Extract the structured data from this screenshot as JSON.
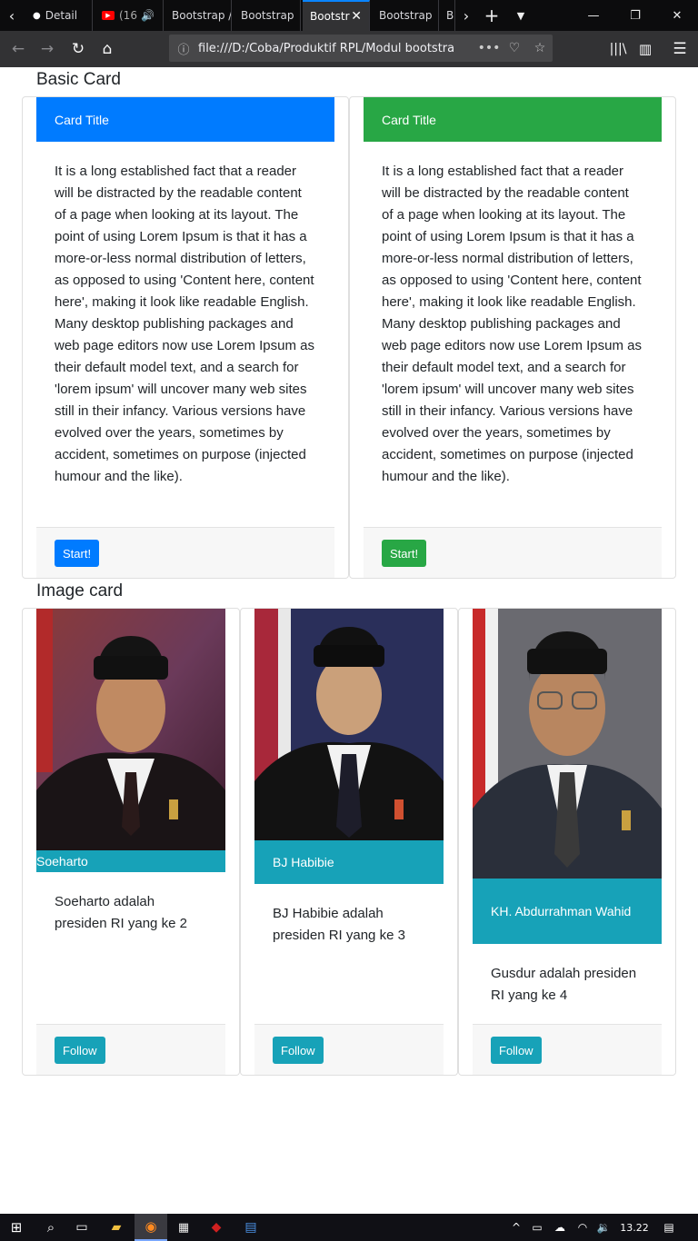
{
  "browser": {
    "tabs": [
      {
        "label": "Detail",
        "icon": "dot-icon",
        "active": false
      },
      {
        "label": "(16",
        "icon": "youtube-icon",
        "active": false
      },
      {
        "label": "Bootstrap /",
        "active": false
      },
      {
        "label": "Bootstrap",
        "active": false
      },
      {
        "label": "Bootstr",
        "active": true
      },
      {
        "label": "Bootstrap",
        "active": false
      },
      {
        "label": "B",
        "active": false
      }
    ],
    "url": "file:///D:/Coba/Produktif RPL/Modul bootstra",
    "url_more": "•••"
  },
  "page": {
    "basic_section_title": "Basic Card",
    "basic_cards": [
      {
        "header": "Card Title",
        "header_color": "#007bff",
        "body": "It is a long established fact that a reader will be distracted by the readable content of a page when looking at its layout. The point of using Lorem Ipsum is that it has a more-or-less normal distribution of letters, as opposed to using 'Content here, content here', making it look like readable English. Many desktop publishing packages and web page editors now use Lorem Ipsum as their default model text, and a search for 'lorem ipsum' will uncover many web sites still in their infancy. Various versions have evolved over the years, sometimes by accident, sometimes on purpose (injected humour and the like).",
        "button": "Start!",
        "button_color": "#007bff"
      },
      {
        "header": "Card Title",
        "header_color": "#28a745",
        "body": "It is a long established fact that a reader will be distracted by the readable content of a page when looking at its layout. The point of using Lorem Ipsum is that it has a more-or-less normal distribution of letters, as opposed to using 'Content here, content here', making it look like readable English. Many desktop publishing packages and web page editors now use Lorem Ipsum as their default model text, and a search for 'lorem ipsum' will uncover many web sites still in their infancy. Various versions have evolved over the years, sometimes by accident, sometimes on purpose (injected humour and the like).",
        "button": "Start!",
        "button_color": "#28a745"
      }
    ],
    "image_section_title": "Image card",
    "image_cards": [
      {
        "name": "Soeharto",
        "text": "Soeharto adalah presiden RI yang ke 2",
        "button": "Follow"
      },
      {
        "name": "BJ Habibie",
        "text": "BJ Habibie adalah presiden RI yang ke 3",
        "button": "Follow"
      },
      {
        "name": "KH. Abdurrahman Wahid",
        "text": "Gusdur adalah presiden RI yang ke 4",
        "button": "Follow"
      }
    ],
    "info_color": "#17a2b8"
  },
  "taskbar": {
    "clock": "13.22"
  }
}
